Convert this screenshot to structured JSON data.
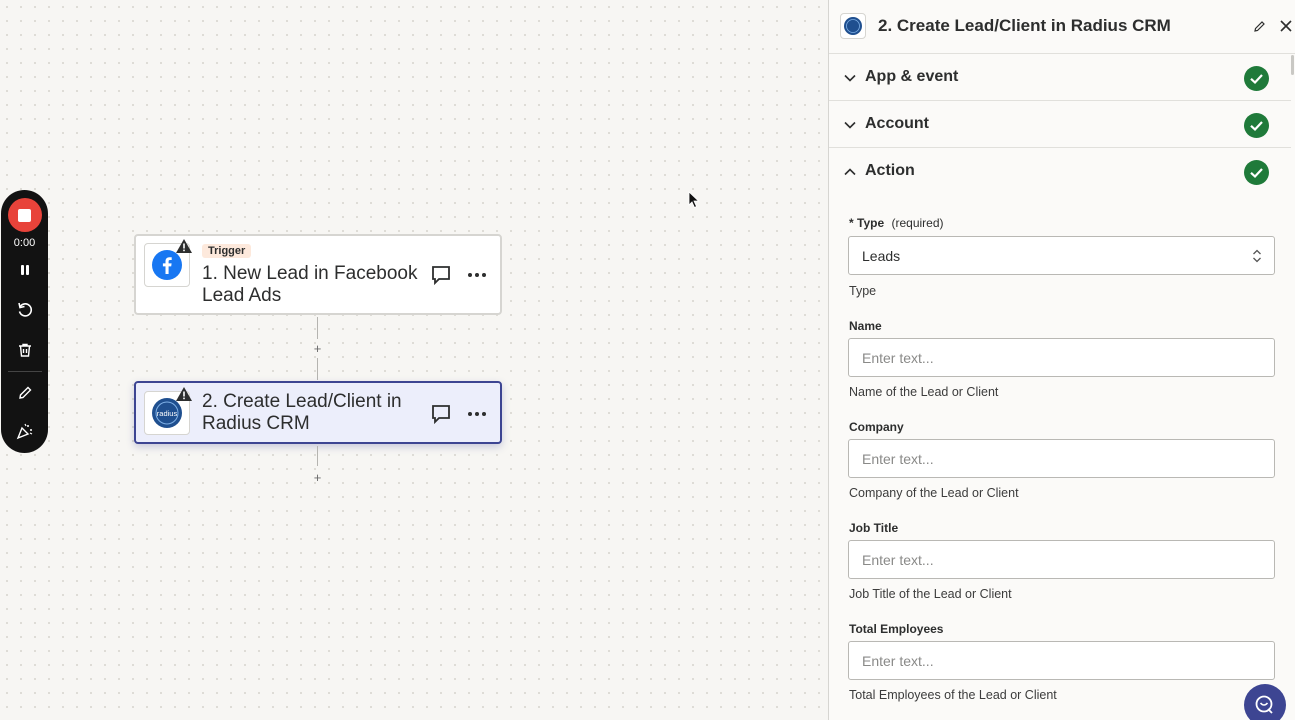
{
  "recorder": {
    "time": "0:00"
  },
  "canvas": {
    "trigger_node": {
      "badge": "Trigger",
      "title": "1. New Lead in Facebook Lead Ads",
      "icon": "facebook-icon"
    },
    "action_node": {
      "title": "2. Create Lead/Client in Radius CRM",
      "icon": "radius-icon",
      "icon_text": "radius"
    }
  },
  "panel": {
    "title": "2. Create Lead/Client in Radius CRM",
    "sections": [
      {
        "label": "App & event",
        "state": "collapsed",
        "complete": true
      },
      {
        "label": "Account",
        "state": "collapsed",
        "complete": true
      },
      {
        "label": "Action",
        "state": "expanded",
        "complete": true
      }
    ],
    "fields": {
      "type": {
        "asterisk": "*",
        "label": "Type",
        "required_text": "(required)",
        "value": "Leads",
        "help": "Type"
      },
      "name": {
        "label": "Name",
        "placeholder": "Enter text...",
        "help": "Name of the Lead or Client"
      },
      "company": {
        "label": "Company",
        "placeholder": "Enter text...",
        "help": "Company of the Lead or Client"
      },
      "job_title": {
        "label": "Job Title",
        "placeholder": "Enter text...",
        "help": "Job Title of the Lead or Client"
      },
      "total_employees": {
        "label": "Total Employees",
        "placeholder": "Enter text...",
        "help": "Total Employees of the Lead or Client"
      }
    }
  },
  "colors": {
    "accent": "#3d4592",
    "success": "#1f7a3a",
    "record": "#e8433a",
    "facebook": "#1877f2"
  }
}
